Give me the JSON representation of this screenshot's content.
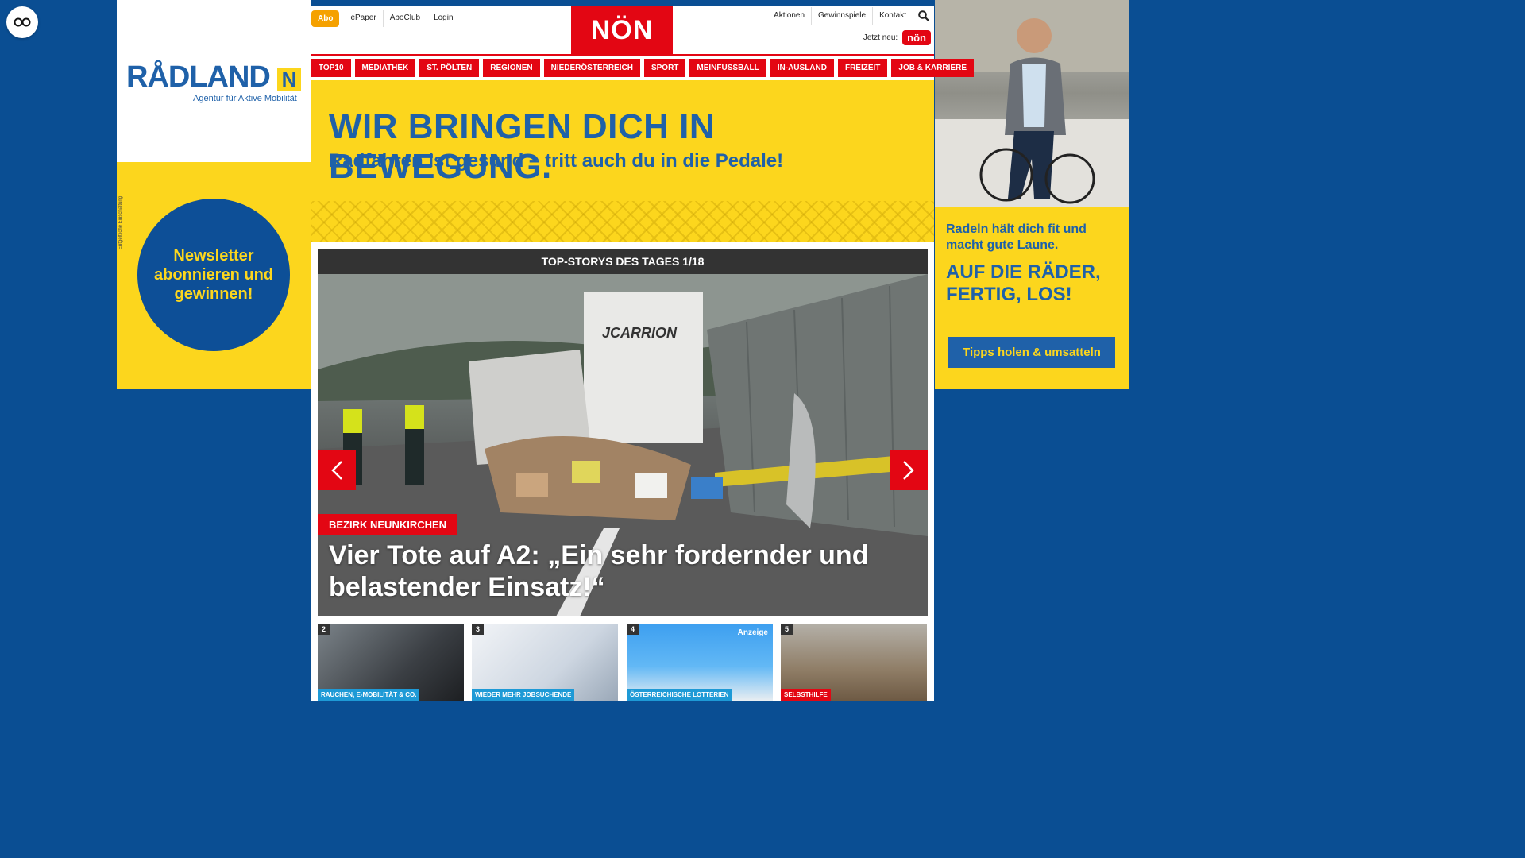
{
  "float_icon": "glasses-icon",
  "left_ad": {
    "logo_text": "RÅDLAND",
    "logo_badge": "N",
    "logo_subtitle": "Agentur für Aktive Mobilität",
    "newsletter_text": "Newsletter abonnieren und gewinnen!",
    "disclaimer": "Entgeltliche Einschaltung"
  },
  "right_ad": {
    "line1": "Radeln hält dich fit und macht gute Laune.",
    "line2": "AUF DIE RÄDER, FERTIG, LOS!",
    "button": "Tipps holen & umsatteln"
  },
  "header": {
    "abo": "Abo",
    "meta_links": [
      "ePaper",
      "AboClub",
      "Login"
    ],
    "logo": "NÖN",
    "right_links": [
      "Aktionen",
      "Gewinnspiele",
      "Kontakt"
    ],
    "jetzt_neu": "Jetzt neu:",
    "jetzt_badge": "nön"
  },
  "main_nav": [
    "TOP10",
    "MEDIATHEK",
    "ST. PÖLTEN",
    "REGIONEN",
    "NIEDERÖSTERREICH",
    "SPORT",
    "MEINFUSSBALL",
    "IN-AUSLAND",
    "FREIZEIT",
    "JOB & KARRIERE"
  ],
  "banner": {
    "headline": "WIR BRINGEN DICH IN BEWEGUNG.",
    "subline": "Radfahren ist gesund – tritt auch du in die Pedale!"
  },
  "slider": {
    "heading": "TOP-STORYS DES TAGES 1/18",
    "truck_text": "JCARRION",
    "tag": "BEZIRK NEUNKIRCHEN",
    "title": "Vier Tote auf A2: „Ein sehr fordernder und belastender Einsatz!“"
  },
  "thumbs": [
    {
      "num": "2",
      "cat": "RAUCHEN, E-MOBILITÄT & CO.",
      "cat_color": "#1e9ad6"
    },
    {
      "num": "3",
      "cat": "WIEDER MEHR JOBSUCHENDE",
      "cat_color": "#1e9ad6"
    },
    {
      "num": "4",
      "cat": "ÖSTERREICHISCHE LOTTERIEN",
      "cat_color": "#1e9ad6",
      "badge": "Anzeige"
    },
    {
      "num": "5",
      "cat": "SELBSTHILFE",
      "cat_color": "#e30613"
    }
  ]
}
